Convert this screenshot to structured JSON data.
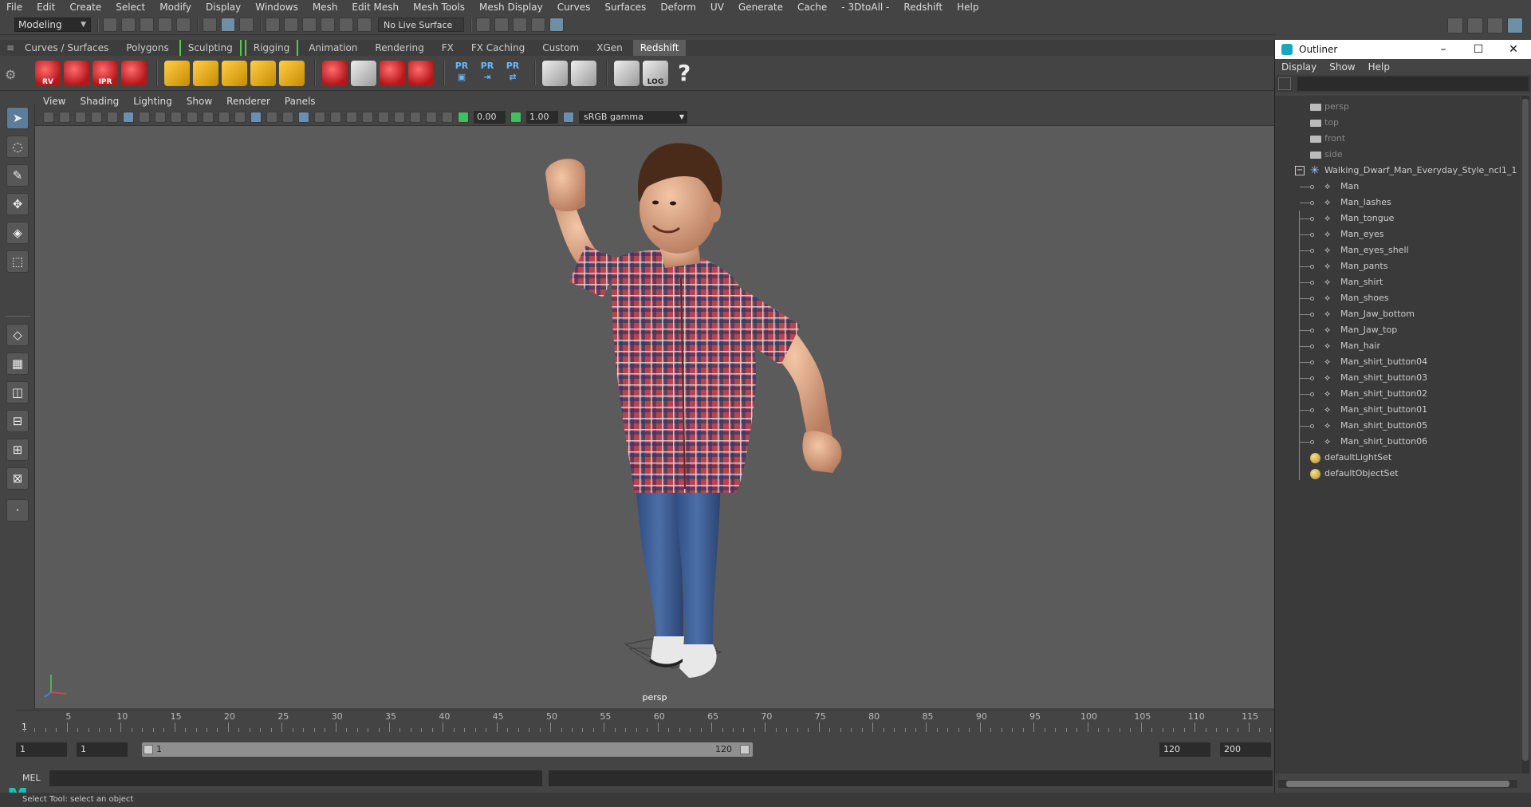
{
  "menubar": [
    "File",
    "Edit",
    "Create",
    "Select",
    "Modify",
    "Display",
    "Windows",
    "Mesh",
    "Edit Mesh",
    "Mesh Tools",
    "Mesh Display",
    "Curves",
    "Surfaces",
    "Deform",
    "UV",
    "Generate",
    "Cache",
    "- 3DtoAll -",
    "Redshift",
    "Help"
  ],
  "statusline": {
    "mode": "Modeling",
    "live_surface": "No Live Surface"
  },
  "shelf_tabs": [
    {
      "label": "Curves / Surfaces"
    },
    {
      "label": "Polygons"
    },
    {
      "label": "Sculpting"
    },
    {
      "label": "Rigging"
    },
    {
      "label": "Animation"
    },
    {
      "label": "Rendering"
    },
    {
      "label": "FX"
    },
    {
      "label": "FX Caching"
    },
    {
      "label": "Custom"
    },
    {
      "label": "XGen"
    },
    {
      "label": "Redshift"
    }
  ],
  "shelf": {
    "rv_tag": "RV",
    "ipr_tag": "IPR",
    "pr_labels": [
      "PR",
      "PR",
      "PR"
    ],
    "log_tag": "LOG",
    "help": "?"
  },
  "viewport": {
    "menu": [
      "View",
      "Shading",
      "Lighting",
      "Show",
      "Renderer",
      "Panels"
    ],
    "exposure": "0.00",
    "gamma": "1.00",
    "color_space": "sRGB gamma",
    "camera": "persp"
  },
  "timeline": {
    "ticks": [
      5,
      10,
      15,
      20,
      25,
      30,
      35,
      40,
      45,
      50,
      55,
      60,
      65,
      70,
      75,
      80,
      85,
      90,
      95,
      100,
      105,
      110,
      115
    ],
    "current": "1"
  },
  "range": {
    "start": "1",
    "playback_start": "1",
    "bar_low": "1",
    "bar_high": "120",
    "playback_end": "120",
    "end": "200"
  },
  "cmdline": {
    "lang": "MEL"
  },
  "helpline": "Select Tool: select an object",
  "outliner": {
    "title": "Outliner",
    "menu": [
      "Display",
      "Show",
      "Help"
    ],
    "cameras": [
      "persp",
      "top",
      "front",
      "side"
    ],
    "group": "Walking_Dwarf_Man_Everyday_Style_ncl1_1",
    "children": [
      "Man",
      "Man_lashes",
      "Man_tongue",
      "Man_eyes",
      "Man_eyes_shell",
      "Man_pants",
      "Man_shirt",
      "Man_shoes",
      "Man_Jaw_bottom",
      "Man_Jaw_top",
      "Man_hair",
      "Man_shirt_button04",
      "Man_shirt_button03",
      "Man_shirt_button02",
      "Man_shirt_button01",
      "Man_shirt_button05",
      "Man_shirt_button06"
    ],
    "sets": [
      "defaultLightSet",
      "defaultObjectSet"
    ]
  },
  "colors": {
    "viewport_bg": "#5b5b5b",
    "active_tab": "#5d5d5d",
    "bracket": "#46d146",
    "accent": "#19c2c2"
  }
}
